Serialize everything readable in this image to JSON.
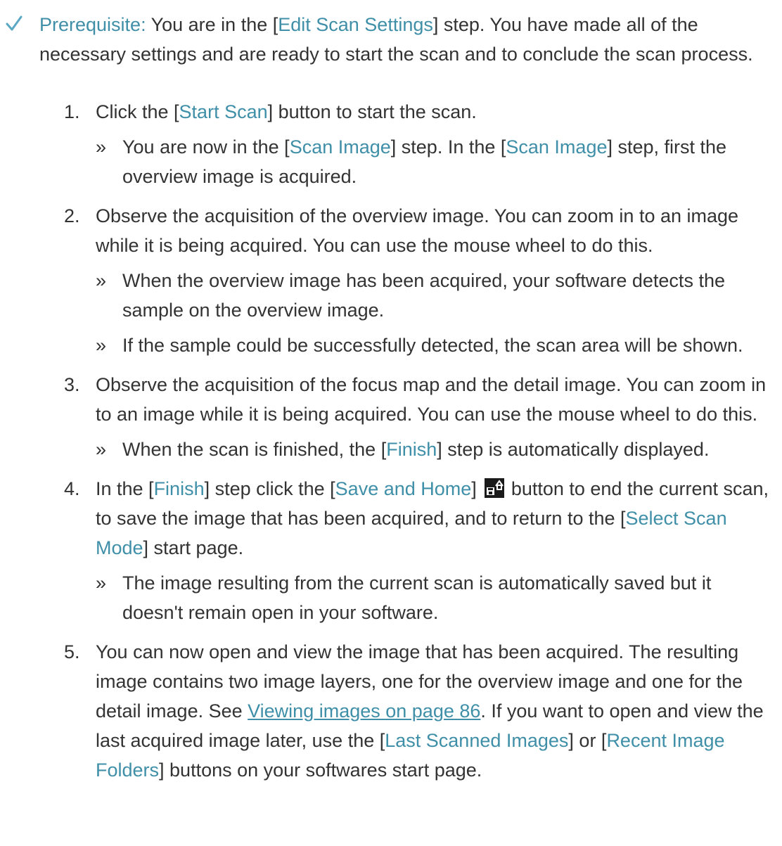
{
  "prerequisite": {
    "label": "Prerequisite:",
    "t1": " You are in the [",
    "k1": "Edit Scan Settings",
    "t2": "] step. You have made all of the necessary settings and are ready to start the scan and to conclude the scan process."
  },
  "steps": [
    {
      "num": "1.",
      "text": [
        {
          "t": "Click the ["
        },
        {
          "k": "Start Scan"
        },
        {
          "t": "] button to start the scan."
        }
      ],
      "results": [
        {
          "parts": [
            {
              "t": "You are now in the ["
            },
            {
              "k": "Scan Image"
            },
            {
              "t": "] step. In the ["
            },
            {
              "k": "Scan Image"
            },
            {
              "t": "] step, first the overview image is acquired."
            }
          ]
        }
      ]
    },
    {
      "num": "2.",
      "text": [
        {
          "t": "Observe the acquisition of the overview image. You can zoom in to an image while it is being acquired. You can use the mouse wheel to do this."
        }
      ],
      "results": [
        {
          "parts": [
            {
              "t": "When the overview image has been acquired, your software detects the sample on the overview image."
            }
          ]
        },
        {
          "parts": [
            {
              "t": "If the sample could be successfully detected, the scan area will be shown."
            }
          ]
        }
      ]
    },
    {
      "num": "3.",
      "text": [
        {
          "t": "Observe the acquisition of the focus map and the detail image. You can zoom in to an image while it is being acquired. You can use the mouse wheel to do this."
        }
      ],
      "results": [
        {
          "parts": [
            {
              "t": "When the scan is finished, the ["
            },
            {
              "k": "Finish"
            },
            {
              "t": "] step is automatically displayed."
            }
          ]
        }
      ]
    },
    {
      "num": "4.",
      "text": [
        {
          "t": "In the ["
        },
        {
          "k": "Finish"
        },
        {
          "t": "] step click the ["
        },
        {
          "k": "Save and Home"
        },
        {
          "t": "] "
        },
        {
          "icon": "save-home-icon"
        },
        {
          "t": " button to end the current scan, to save the image that has been acquired, and to return to the ["
        },
        {
          "k": "Select Scan Mode"
        },
        {
          "t": "] start page."
        }
      ],
      "results": [
        {
          "parts": [
            {
              "t": "The image resulting from the current scan is automatically saved but it doesn't remain open in your software."
            }
          ]
        }
      ]
    },
    {
      "num": "5.",
      "text": [
        {
          "t": "You can now open and view the image that has been acquired. The resulting image contains two image layers, one for the overview image and one for the detail image. See "
        },
        {
          "link": "Viewing images on page 86"
        },
        {
          "t": ". If you want to open and view the last acquired image later, use the ["
        },
        {
          "k": "Last Scanned Images"
        },
        {
          "t": "] or ["
        },
        {
          "k": "Recent Image Folders"
        },
        {
          "t": "] buttons on your softwares start page."
        }
      ],
      "results": []
    }
  ],
  "result_marker": "»",
  "colors": {
    "keyword": "#3f8fa8",
    "text": "#333333",
    "check": "#5aa8c4",
    "icon_bg": "#1a1a1a"
  }
}
